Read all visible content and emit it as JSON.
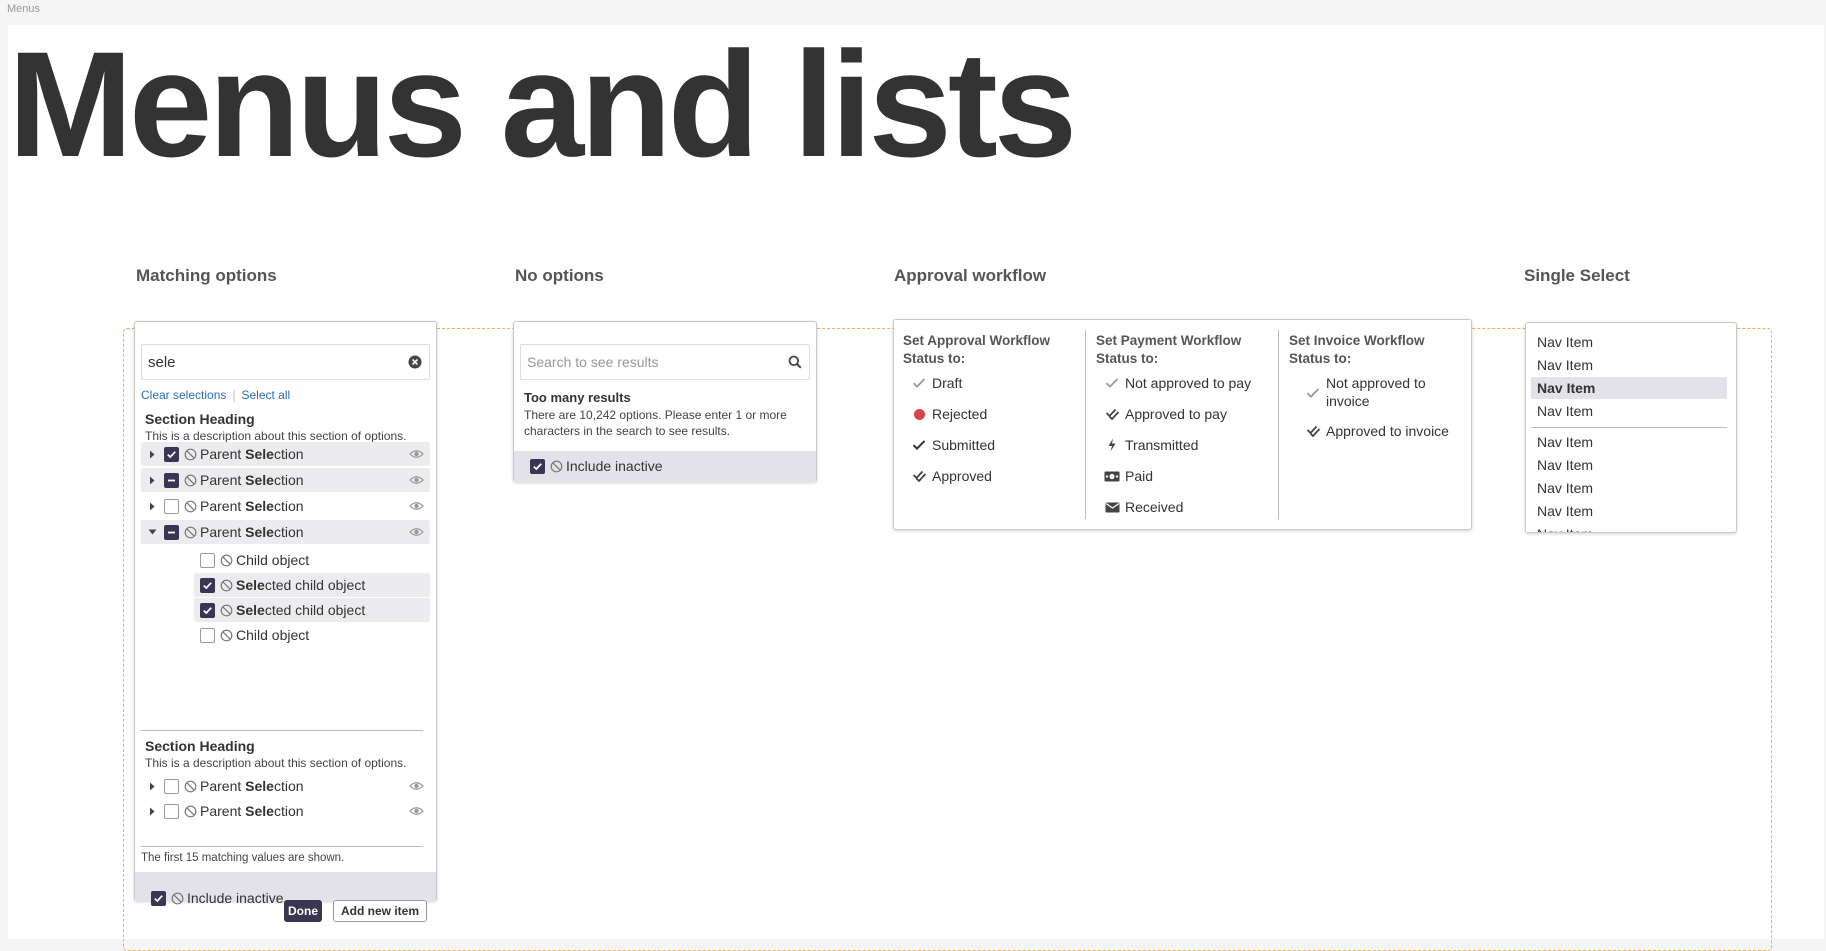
{
  "page": {
    "frame_label": "Menus",
    "title": "Menus and lists"
  },
  "columns": {
    "matching": "Matching options",
    "no_options": "No options",
    "approval": "Approval workflow",
    "single_select": "Single Select"
  },
  "matching": {
    "search_value": "sele",
    "clear_selections": "Clear selections",
    "select_all": "Select all",
    "section1": {
      "heading": "Section Heading",
      "description": "This is a description about this section of options."
    },
    "section2": {
      "heading": "Section Heading",
      "description": "This is a description about this section of options."
    },
    "rows": [
      {
        "pre": "Parent ",
        "match": "Sele",
        "post": "ction",
        "state": "checked",
        "expanded": false
      },
      {
        "pre": "Parent ",
        "match": "Sele",
        "post": "ction",
        "state": "mixed",
        "expanded": false
      },
      {
        "pre": "Parent ",
        "match": "Sele",
        "post": "ction",
        "state": "unchecked",
        "expanded": false
      },
      {
        "pre": "Parent ",
        "match": "Sele",
        "post": "ction",
        "state": "mixed",
        "expanded": true
      }
    ],
    "children": [
      {
        "pre": "",
        "match": "",
        "post": "Child object",
        "state": "unchecked"
      },
      {
        "pre": "",
        "match": "Sele",
        "post": "cted child object",
        "state": "checked"
      },
      {
        "pre": "",
        "match": "Sele",
        "post": "cted child object",
        "state": "checked"
      },
      {
        "pre": "",
        "match": "",
        "post": "Child object",
        "state": "unchecked"
      }
    ],
    "rows2": [
      {
        "pre": "Parent ",
        "match": "Sele",
        "post": "ction",
        "state": "unchecked"
      },
      {
        "pre": "Parent ",
        "match": "Sele",
        "post": "ction",
        "state": "unchecked"
      }
    ],
    "footnote": "The first 15 matching values are shown.",
    "include_inactive": "Include inactive",
    "done_label": "Done",
    "add_label": "Add new item"
  },
  "no_options": {
    "placeholder": "Search to see results",
    "message_title": "Too many results",
    "message_body_1": "There are 10,242 options. Please enter 1 or more",
    "message_body_2": "characters in the search to see results.",
    "include_inactive": "Include inactive"
  },
  "approval": {
    "approval_col": {
      "heading_1": "Set Approval Workflow",
      "heading_2": "Status to:",
      "items": [
        {
          "label": "Draft",
          "icon": "check-light-icon"
        },
        {
          "label": "Rejected",
          "icon": "red-dot-icon"
        },
        {
          "label": "Submitted",
          "icon": "check-icon"
        },
        {
          "label": "Approved",
          "icon": "double-check-icon"
        }
      ]
    },
    "payment_col": {
      "heading_1": "Set Payment Workflow",
      "heading_2": "Status to:",
      "items": [
        {
          "label": "Not approved to pay",
          "icon": "check-light-icon"
        },
        {
          "label": "Approved to pay",
          "icon": "double-check-icon"
        },
        {
          "label": "Transmitted",
          "icon": "bolt-icon"
        },
        {
          "label": "Paid",
          "icon": "money-icon"
        },
        {
          "label": "Received",
          "icon": "envelope-icon"
        }
      ]
    },
    "invoice_col": {
      "heading_1": "Set Invoice Workflow",
      "heading_2": "Status to:",
      "items": [
        {
          "label_1": "Not approved to",
          "label_2": "invoice",
          "icon": "check-light-icon"
        },
        {
          "label_1": "Approved to invoice",
          "icon": "double-check-icon"
        }
      ]
    }
  },
  "single_select": {
    "items": [
      "Nav Item",
      "Nav Item",
      "Nav Item",
      "Nav Item",
      "Nav Item",
      "Nav Item",
      "Nav Item",
      "Nav Item",
      "Nav Item"
    ],
    "selected_index": 2
  },
  "colors": {
    "accent": "#3b3554",
    "link": "#2a6ebb",
    "dashed_border": "#f0b24a",
    "rejected_dot": "#d94545",
    "row_shade": "#ececef"
  }
}
